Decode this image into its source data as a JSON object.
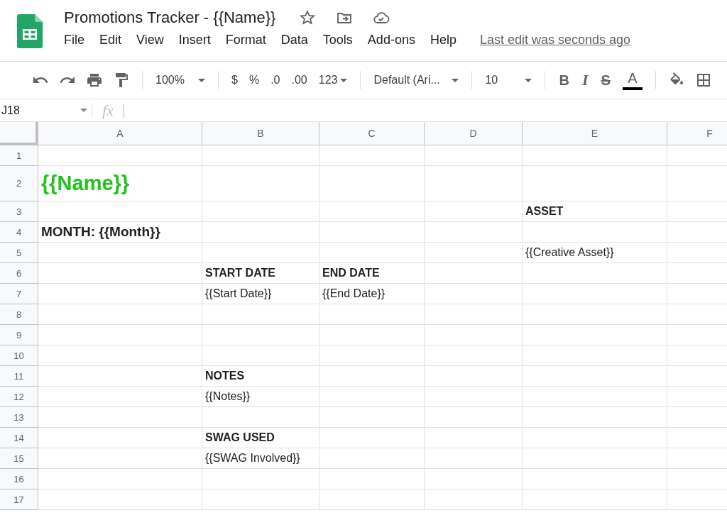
{
  "document": {
    "title": "Promotions Tracker - {{Name}}",
    "menu": [
      "File",
      "Edit",
      "View",
      "Insert",
      "Format",
      "Data",
      "Tools",
      "Add-ons",
      "Help"
    ],
    "last_edit": "Last edit was seconds ago"
  },
  "toolbar": {
    "zoom": "100%",
    "currency": "$",
    "percent": "%",
    "decrease_decimal": ".0",
    "increase_decimal": ".00",
    "number_format": "123",
    "font": "Default (Ari...",
    "font_size": "10",
    "bold": "B",
    "italic": "I",
    "strikethrough": "S",
    "text_color": "A"
  },
  "formula_bar": {
    "cell_reference": "J18",
    "fx": "fx"
  },
  "columns": [
    "A",
    "B",
    "C",
    "D",
    "E",
    "F"
  ],
  "rows": [
    {
      "number": "1",
      "cells": [
        null,
        null,
        null,
        null,
        null,
        null
      ]
    },
    {
      "number": "2",
      "cells": [
        {
          "text": "{{Name}}",
          "kind": "title"
        },
        null,
        null,
        null,
        null,
        null
      ]
    },
    {
      "number": "3",
      "cells": [
        null,
        null,
        null,
        null,
        {
          "text": "ASSET",
          "kind": "heading"
        },
        null
      ]
    },
    {
      "number": "4",
      "cells": [
        {
          "text": "MONTH: {{Month}}",
          "kind": "subtitle"
        },
        null,
        null,
        null,
        null,
        null
      ]
    },
    {
      "number": "5",
      "cells": [
        null,
        null,
        null,
        null,
        {
          "text": "{{Creative Asset}}",
          "kind": "plain"
        },
        null
      ]
    },
    {
      "number": "6",
      "cells": [
        null,
        {
          "text": "START DATE",
          "kind": "heading"
        },
        {
          "text": "END DATE",
          "kind": "heading"
        },
        null,
        null,
        null
      ]
    },
    {
      "number": "7",
      "cells": [
        null,
        {
          "text": "{{Start Date}}",
          "kind": "plain"
        },
        {
          "text": "{{End Date}}",
          "kind": "plain"
        },
        null,
        null,
        null
      ]
    },
    {
      "number": "8",
      "cells": [
        null,
        null,
        null,
        null,
        null,
        null
      ]
    },
    {
      "number": "9",
      "cells": [
        null,
        null,
        null,
        null,
        null,
        null
      ]
    },
    {
      "number": "10",
      "cells": [
        null,
        null,
        null,
        null,
        null,
        null
      ]
    },
    {
      "number": "11",
      "cells": [
        null,
        {
          "text": "NOTES",
          "kind": "heading"
        },
        null,
        null,
        null,
        null
      ]
    },
    {
      "number": "12",
      "cells": [
        null,
        {
          "text": "{{Notes}}",
          "kind": "plain"
        },
        null,
        null,
        null,
        null
      ]
    },
    {
      "number": "13",
      "cells": [
        null,
        null,
        null,
        null,
        null,
        null
      ]
    },
    {
      "number": "14",
      "cells": [
        null,
        {
          "text": "SWAG USED",
          "kind": "heading"
        },
        null,
        null,
        null,
        null
      ]
    },
    {
      "number": "15",
      "cells": [
        null,
        {
          "text": "{{SWAG Involved}}",
          "kind": "plain"
        },
        null,
        null,
        null,
        null
      ]
    },
    {
      "number": "16",
      "cells": [
        null,
        null,
        null,
        null,
        null,
        null
      ]
    },
    {
      "number": "17",
      "cells": [
        null,
        null,
        null,
        null,
        null,
        null
      ]
    }
  ]
}
